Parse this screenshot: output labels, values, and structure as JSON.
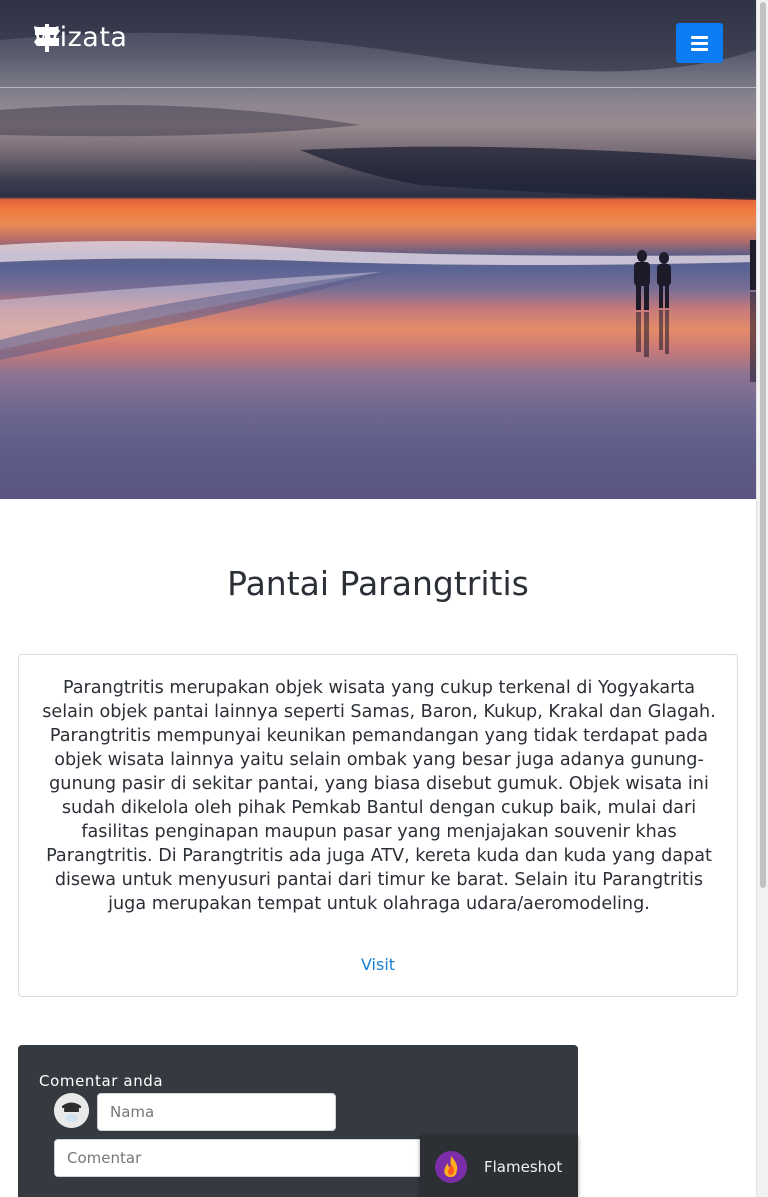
{
  "navbar": {
    "brand": "Wizata",
    "brand_icon": "signpost-icon",
    "menu_icon": "hamburger-icon",
    "menu_color": "#0d7cf2"
  },
  "main": {
    "title": "Pantai Parangtritis",
    "description": "Parangtritis merupakan objek wisata yang cukup terkenal di Yogyakarta selain objek pantai lainnya seperti Samas, Baron, Kukup, Krakal dan Glagah. Parangtritis mempunyai keunikan pemandangan yang tidak terdapat pada objek wisata lainnya yaitu selain ombak yang besar juga adanya gunung-gunung pasir di sekitar pantai, yang biasa disebut gumuk. Objek wisata ini sudah dikelola oleh pihak Pemkab Bantul dengan cukup baik, mulai dari fasilitas penginapan maupun pasar yang menjajakan souvenir khas Parangtritis. Di Parangtritis ada juga ATV, kereta kuda dan kuda yang dapat disewa untuk menyusuri pantai dari timur ke barat. Selain itu Parangtritis juga merupakan tempat untuk olahraga udara/aeromodeling.",
    "visit_label": "Visit",
    "link_color": "#1a7fd4"
  },
  "comment": {
    "label": "Comentar anda",
    "name_placeholder": "Nama",
    "comment_placeholder": "Comentar",
    "avatar_icon": "user-avatar-icon",
    "panel_color": "#343a40"
  },
  "overlay": {
    "app_name": "Flameshot",
    "app_icon": "flameshot-icon"
  }
}
